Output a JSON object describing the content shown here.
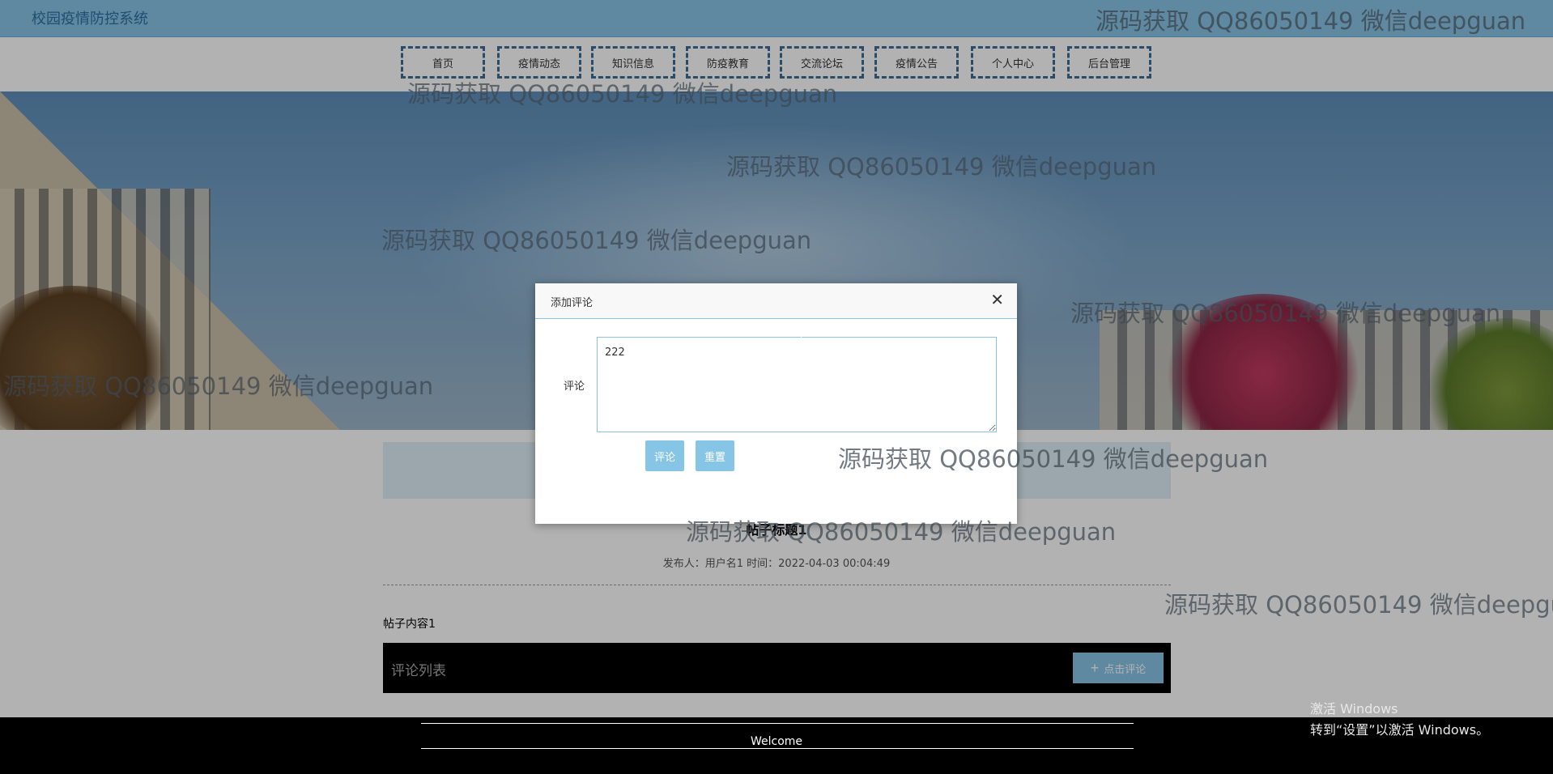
{
  "header": {
    "brand": "校园疫情防控系统"
  },
  "nav": {
    "items": [
      "首页",
      "疫情动态",
      "知识信息",
      "防疫教育",
      "交流论坛",
      "疫情公告",
      "个人中心",
      "后台管理"
    ]
  },
  "post": {
    "title": "帖子标题1",
    "meta": "发布人：用户名1 时间：2022-04-03 00:04:49",
    "content": "帖子内容1",
    "comment_list_title": "评论列表",
    "click_comment_label": "点击评论"
  },
  "modal": {
    "title": "添加评论",
    "field_label": "评论",
    "comment_value": "222",
    "submit_label": "评论",
    "reset_label": "重置"
  },
  "footer": {
    "welcome": "Welcome"
  },
  "watermark": {
    "text": "源码获取 QQ86050149 微信deepguan"
  },
  "windows": {
    "activate_title": "激活 Windows",
    "activate_hint": "转到“设置”以激活 Windows。"
  },
  "icons": {
    "close": "close-icon",
    "plus": "plus-icon"
  },
  "colors": {
    "accent": "#87c5e6",
    "nav_border": "#3d6d96",
    "footer": "#000000"
  }
}
